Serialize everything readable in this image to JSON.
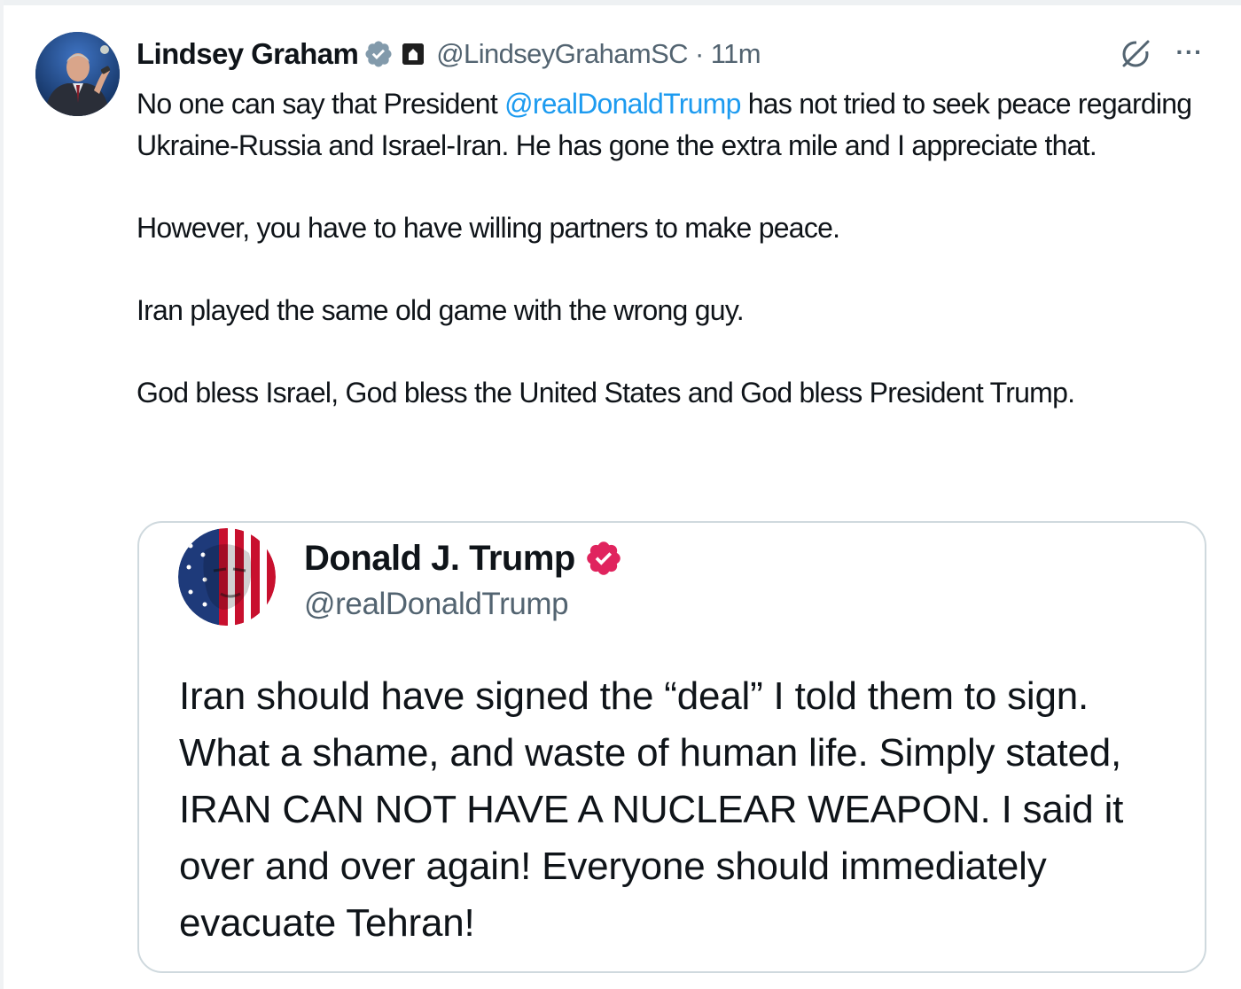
{
  "tweet": {
    "author": {
      "name": "Lindsey Graham",
      "handle": "@LindseyGrahamSC",
      "time": "11m",
      "separator": "·",
      "avatar_icon": "profile-photo"
    },
    "paragraphs": [
      {
        "before": "No one can say that President ",
        "mention": "@realDonaldTrump",
        "after": " has not tried to seek peace regarding Ukraine-Russia and Israel-Iran. He has gone the extra mile and I appreciate that."
      },
      "However, you have to have willing partners to make peace.",
      "Iran played the same old game with the wrong guy.",
      "God bless Israel, God bless the United States and God bless President Trump."
    ],
    "actions": {
      "grok_icon": "grok-icon",
      "more_label": "···"
    }
  },
  "quoted_post": {
    "name": "Donald J. Trump",
    "handle": "@realDonaldTrump",
    "text": "Iran should have signed the “deal” I told them to sign. What a shame, and waste of human life. Simply stated, IRAN CAN NOT HAVE A NUCLEAR WEAPON. I said it over and over again! Everyone should immediately evacuate Tehran!"
  },
  "colors": {
    "link": "#1d9bf0",
    "secondary_text": "#536471",
    "verified_blue": "#1d9bf0",
    "verified_red": "#e0245e",
    "gov_badge": "#222222",
    "card_border": "#cfd9de"
  }
}
